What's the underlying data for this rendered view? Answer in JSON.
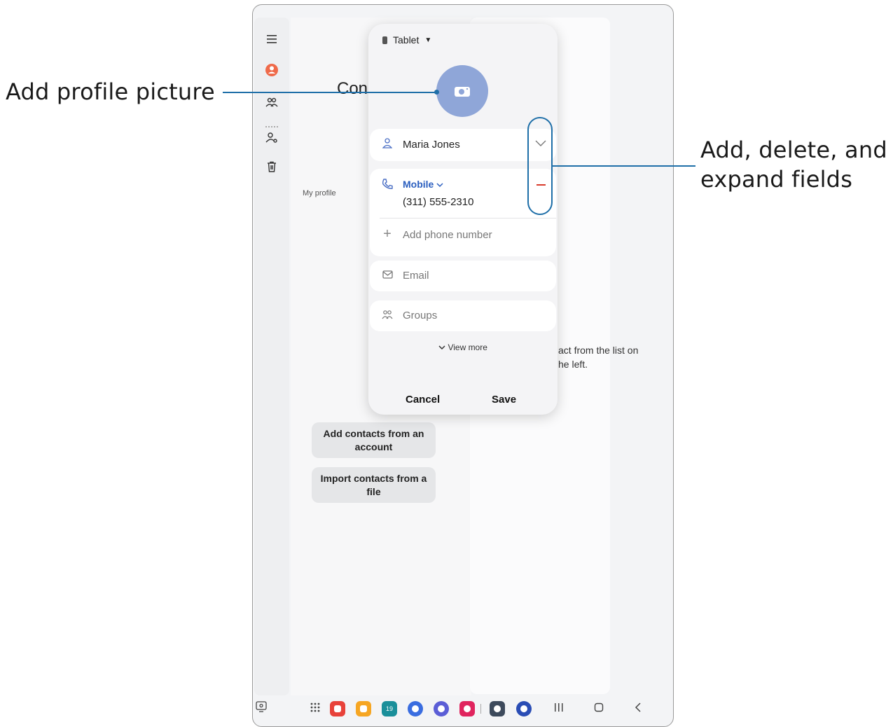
{
  "callouts": {
    "left": "Add profile picture",
    "right_line1": "Add, delete, and",
    "right_line2": "expand fields"
  },
  "background": {
    "title_partial": "Con",
    "my_profile": "My profile",
    "empty_line1": "act from the list on",
    "empty_line2": "he left.",
    "buttons": [
      "Add contacts from an account",
      "Import contacts from a file"
    ]
  },
  "rail_icons": [
    "menu-icon",
    "profile-icon",
    "contacts-icon",
    "person-settings-icon",
    "trash-icon"
  ],
  "modal": {
    "storage_label": "Tablet",
    "name_value": "Maria Jones",
    "phone_type": "Mobile",
    "phone_value": "(311) 555-2310",
    "add_phone_placeholder": "Add phone number",
    "email_placeholder": "Email",
    "groups_placeholder": "Groups",
    "view_more": "View more",
    "cancel": "Cancel",
    "save": "Save"
  },
  "dock": {
    "apps": [
      {
        "name": "app-red-icon",
        "color": "#e8423a"
      },
      {
        "name": "app-orange-icon",
        "color": "#f6a623"
      },
      {
        "name": "calendar-icon",
        "color": "#1a8f9a",
        "label": "19"
      },
      {
        "name": "messages-icon",
        "color": "#3a6de0"
      },
      {
        "name": "internet-icon",
        "color": "#5b5ed6"
      },
      {
        "name": "screen-recorder-icon",
        "color": "#e0245e"
      },
      {
        "name": "settings-icon",
        "color": "#3d4a5c"
      },
      {
        "name": "galaxy-store-icon",
        "color": "#2a4db5"
      }
    ]
  },
  "colors": {
    "accent": "#1f6fa8",
    "avatar": "#8fa6d8",
    "link": "#2b5fbf",
    "remove": "#d83b2b"
  }
}
